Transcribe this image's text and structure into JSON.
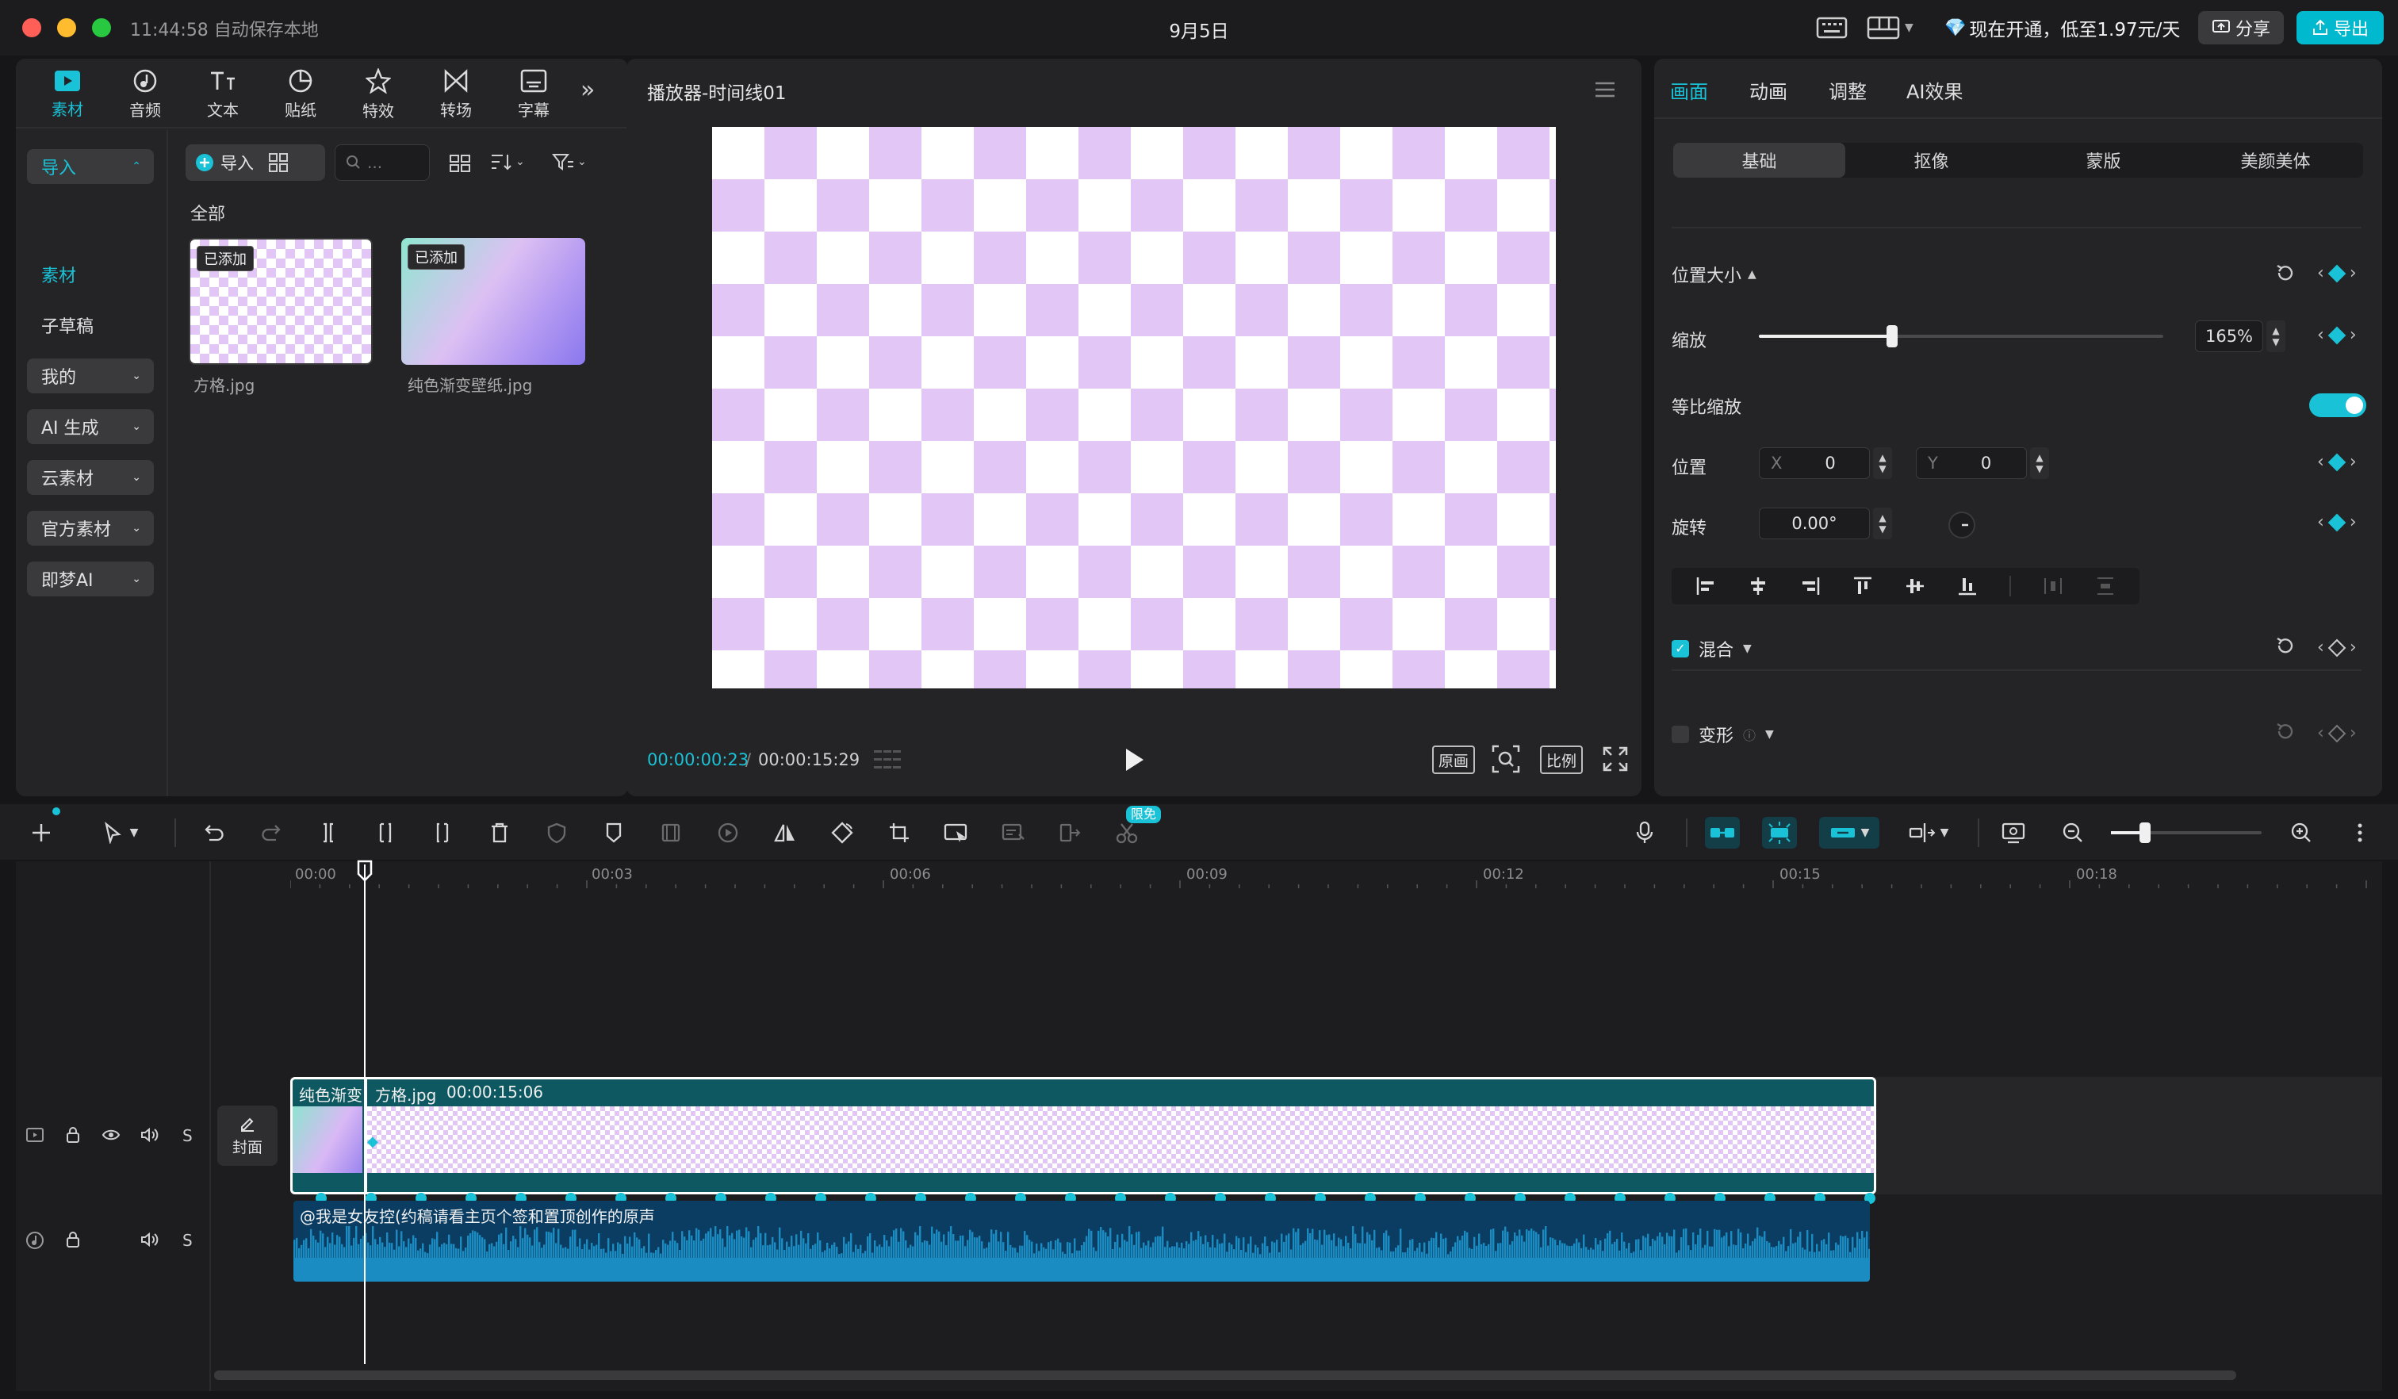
{
  "titlebar": {
    "time_autosave": "11:44:58 自动保存本地",
    "title": "9月5日",
    "promo": "现在开通，低至1.97元/天",
    "share_label": "分享",
    "export_label": "导出"
  },
  "media": {
    "tabs": [
      {
        "label": "素材",
        "icon": "media-icon"
      },
      {
        "label": "音频",
        "icon": "audio-icon"
      },
      {
        "label": "文本",
        "icon": "text-icon"
      },
      {
        "label": "贴纸",
        "icon": "sticker-icon"
      },
      {
        "label": "特效",
        "icon": "effects-icon"
      },
      {
        "label": "转场",
        "icon": "transition-icon"
      },
      {
        "label": "字幕",
        "icon": "subtitle-icon"
      }
    ],
    "sidebar": [
      "导入",
      "素材",
      "子草稿",
      "我的",
      "AI 生成",
      "云素材",
      "官方素材",
      "即梦AI"
    ],
    "import_label": "导入",
    "search_placeholder": "...",
    "all_label": "全部",
    "items": [
      {
        "name": "方格.jpg",
        "badge": "已添加"
      },
      {
        "name": "纯色渐变壁纸.jpg",
        "badge": "已添加"
      }
    ]
  },
  "preview": {
    "title": "播放器-时间线01",
    "current_time": "00:00:00:23",
    "total_time": "00:00:15:29",
    "btn_original": "原画",
    "btn_ratio": "比例"
  },
  "props": {
    "tabs": [
      "画面",
      "动画",
      "调整",
      "AI效果"
    ],
    "subtabs": [
      "基础",
      "抠像",
      "蒙版",
      "美颜美体"
    ],
    "section_position": "位置大小",
    "scale_label": "缩放",
    "scale_value": "165%",
    "scale_fraction": 0.33,
    "uniform_label": "等比缩放",
    "position_label": "位置",
    "x_label": "X",
    "x_value": "0",
    "y_label": "Y",
    "y_value": "0",
    "rotation_label": "旋转",
    "rotation_value": "0.00°",
    "blend_label": "混合",
    "transform_label": "变形"
  },
  "toolbar": {
    "badge": "限免"
  },
  "timeline": {
    "ruler": [
      "00:00",
      "00:03",
      "00:06",
      "00:09",
      "00:12",
      "00:15",
      "00:18"
    ],
    "clip_label_1": "纯色渐变",
    "clip_label_2": "方格.jpg",
    "clip_duration": "00:00:15:06",
    "audio_label": "@我是女友控(约稿请看主页个签和置顶创作的原声",
    "cover_label": "封面",
    "track_s": "S"
  },
  "colors": {
    "accent": "#19c2d6",
    "checker": "#e2c6f6"
  }
}
